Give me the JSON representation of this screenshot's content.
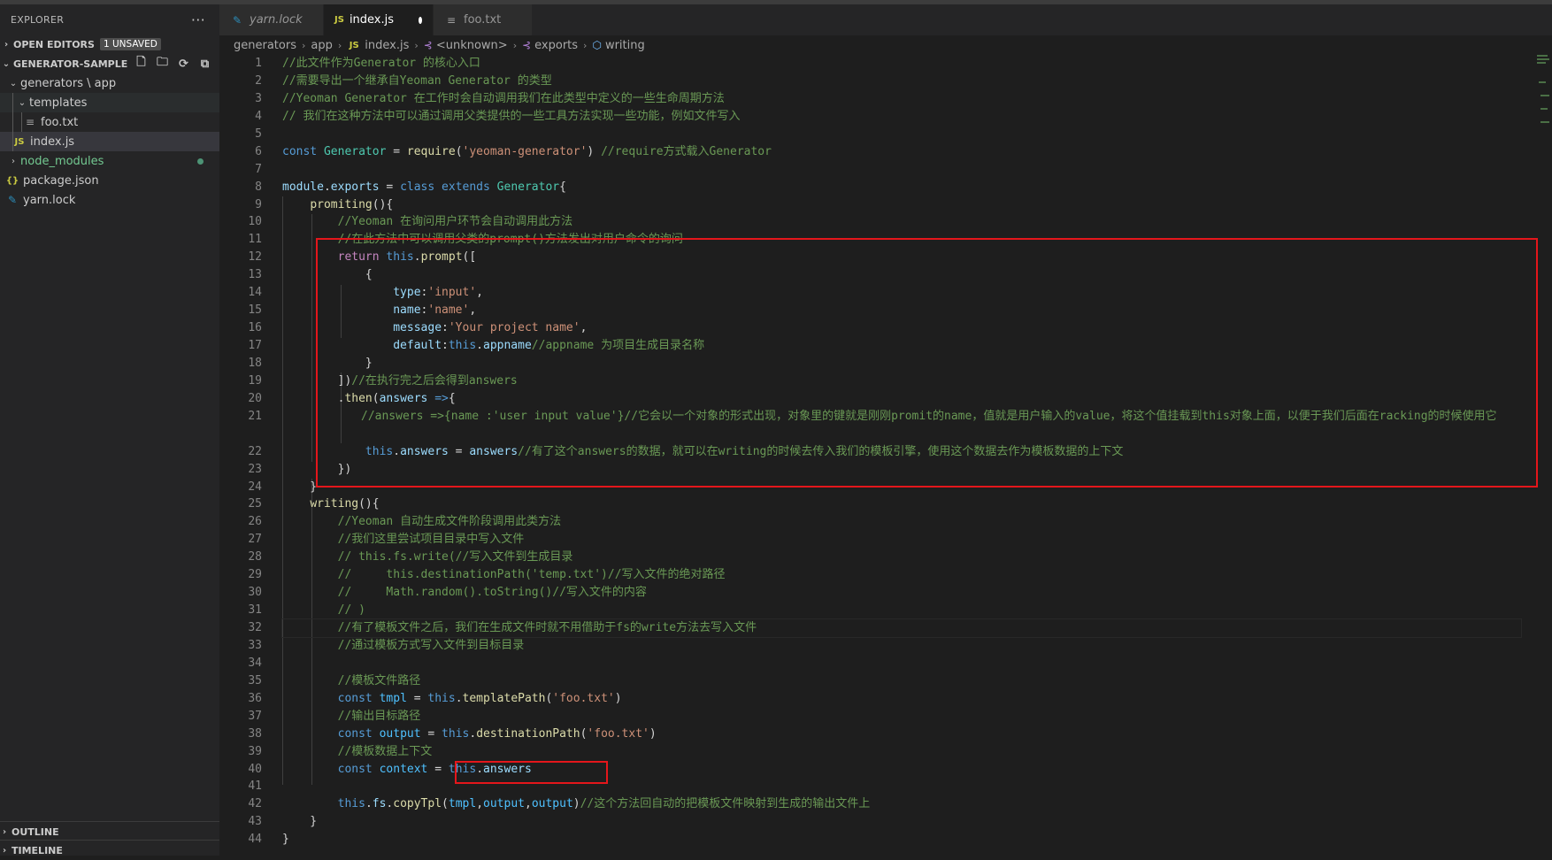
{
  "explorer": {
    "title": "EXPLORER",
    "open_editors_label": "OPEN EDITORS",
    "unsaved_badge": "1 UNSAVED",
    "project_label": "GENERATOR-SAMPLE",
    "tree": {
      "generators_app": "generators \\ app",
      "templates": "templates",
      "foo_txt": "foo.txt",
      "index_js": "index.js",
      "node_modules": "node_modules",
      "package_json": "package.json",
      "yarn_lock": "yarn.lock"
    },
    "outline_label": "OUTLINE",
    "timeline_label": "TIMELINE"
  },
  "tabs": [
    {
      "label": "yarn.lock"
    },
    {
      "label": "index.js"
    },
    {
      "label": "foo.txt"
    }
  ],
  "breadcrumbs": [
    "generators",
    "app",
    "index.js",
    "<unknown>",
    "exports",
    "writing"
  ],
  "code": {
    "line_numbers": [
      "1",
      "2",
      "3",
      "4",
      "5",
      "6",
      "7",
      "8",
      "9",
      "10",
      "11",
      "12",
      "13",
      "14",
      "15",
      "16",
      "17",
      "18",
      "19",
      "20",
      "21",
      "22",
      "23",
      "24",
      "25",
      "26",
      "27",
      "28",
      "29",
      "30",
      "31",
      "32",
      "33",
      "34",
      "35",
      "36",
      "37",
      "38",
      "39",
      "40",
      "41",
      "42",
      "43",
      "44"
    ],
    "l1": "//此文件作为Generator 的核心入口",
    "l2": "//需要导出一个继承自Yeoman Generator 的类型",
    "l3": "//Yeoman Generator 在工作时会自动调用我们在此类型中定义的一些生命周期方法",
    "l4": "// 我们在这种方法中可以通过调用父类提供的一些工具方法实现一些功能，例如文件写入",
    "l6_str": "'yeoman-generator'",
    "l6_cm": " //require方式载入Generator",
    "l10": "//Yeoman 在询问用户环节会自动调用此方法",
    "l11": "//在此方法中可以调用父类的prompt()方法发出对用户命令的询问",
    "l14_str": "'input'",
    "l15_str": "'name'",
    "l16_str": "'Your project name'",
    "l17_cm": "//appname 为项目生成目录名称",
    "l19_cm": "//在执行完之后会得到answers",
    "l21_cm": "//answers =>{name :'user input value'}//它会以一个对象的形式出现，对象里的键就是刚刚promit的name，值就是用户输入的value，将这个值挂载到this对象上面，以便于我们后面在racking的时候使用它",
    "l22_cm": "//有了这个answers的数据，就可以在writing的时候去传入我们的模板引擎，使用这个数据去作为模板数据的上下文",
    "l26": "//Yeoman 自动生成文件阶段调用此类方法",
    "l27": "//我们这里尝试项目目录中写入文件",
    "l28": "// this.fs.write(//写入文件到生成目录",
    "l29": "//     this.destinationPath('temp.txt')//写入文件的绝对路径",
    "l30": "//     Math.random().toString()//写入文件的内容",
    "l31": "// )",
    "l32": "//有了模板文件之后，我们在生成文件时就不用借助于fs的write方法去写入文件",
    "l33": "//通过模板方式写入文件到目标目录",
    "l35": "//模板文件路径",
    "l36_str": "'foo.txt'",
    "l37": "//输出目标路径",
    "l38_str": "'foo.txt'",
    "l39": "//模板数据上下文",
    "l42_cm": "//这个方法回自动的把模板文件映射到生成的输出文件上"
  },
  "colors": {
    "highlight_box": "#e4161b",
    "comment": "#6a9955",
    "keyword": "#569cd6",
    "string": "#ce9178"
  }
}
